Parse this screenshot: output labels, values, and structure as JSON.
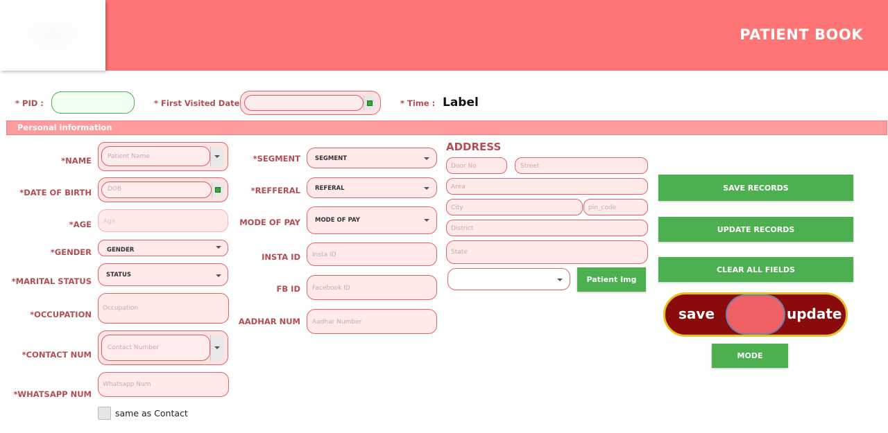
{
  "header": {
    "title": "PATIENT BOOK",
    "logo_icon": "logo-placeholder"
  },
  "top_row": {
    "pid_label": "* PID :",
    "first_visited_label": "* First Visited Date :",
    "time_label": "* Time :",
    "time_value": "Label"
  },
  "section": {
    "personal_information": "Personal information"
  },
  "left_fields": {
    "name_label": "*NAME",
    "name_placeholder": "Patient Name",
    "dob_label": "*DATE OF BIRTH",
    "dob_placeholder": "DOB",
    "age_label": "*AGE",
    "age_placeholder": "Age",
    "gender_label": "*GENDER",
    "gender_value": "GENDER",
    "marital_label": "*MARITAL STATUS",
    "marital_value": "STATUS",
    "occupation_label": "*OCCUPATION",
    "occupation_placeholder": "Occupation",
    "contact_label": "*CONTACT NUM",
    "contact_placeholder": "Contact Number",
    "whatsapp_label": "*WHATSAPP NUM",
    "whatsapp_placeholder": "Whatsapp Num",
    "same_as_contact": "same as Contact"
  },
  "middle_fields": {
    "segment_label": "*SEGMENT",
    "segment_value": "SEGMENT",
    "referral_label": "*REFFERAL",
    "referral_value": "REFERAL",
    "mode_pay_label": "MODE OF PAY",
    "mode_pay_value": "MODE OF PAY",
    "insta_label": "INSTA ID",
    "insta_placeholder": "Insta ID",
    "fb_label": "FB ID",
    "fb_placeholder": "Facebook ID",
    "aadhar_label": "AADHAR NUM",
    "aadhar_placeholder": "Aadhar Number"
  },
  "address": {
    "title": "ADDRESS",
    "door_placeholder": "Door No",
    "street_placeholder": "Street",
    "area_placeholder": "Area",
    "city_placeholder": "City",
    "pin_placeholder": "pin_code",
    "district_placeholder": "District",
    "state_placeholder": "State",
    "patient_img_button": "Patient Img"
  },
  "actions": {
    "save_records": "SAVE RECORDS",
    "update_records": "UPDATE RECORDS",
    "clear_all": "CLEAR ALL FIELDS",
    "toggle_left": "save",
    "toggle_right": "update",
    "mode": "MODE"
  },
  "colors": {
    "header_bg": "#ff7475",
    "label_text": "#b24d52",
    "field_bg": "#ffe9e9",
    "field_border": "#e06368",
    "button_green": "#4caf50",
    "toggle_bg": "#8a0b0b",
    "toggle_border": "#e6c01e"
  }
}
